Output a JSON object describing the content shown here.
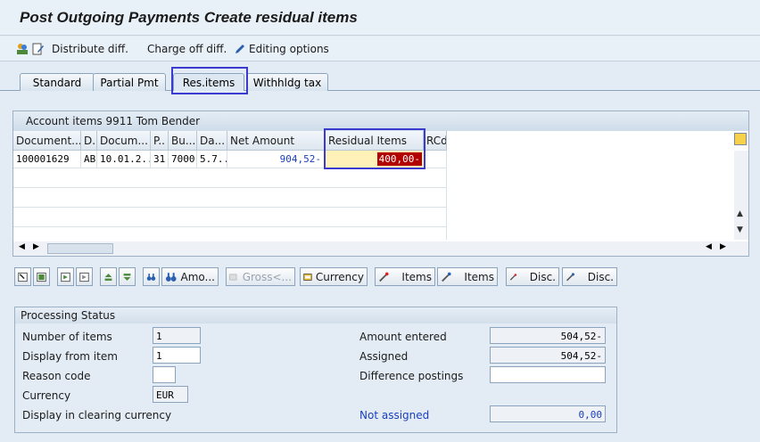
{
  "window": {
    "title": "Post Outgoing Payments Create residual items"
  },
  "toolbar": {
    "distribute_label": "Distribute diff.",
    "charge_off_label": "Charge off diff.",
    "editing_label": "Editing options"
  },
  "tabs": [
    {
      "label": "Standard"
    },
    {
      "label": "Partial Pmt"
    },
    {
      "label": "Res.items"
    },
    {
      "label": "Withhldg tax"
    }
  ],
  "grid": {
    "title": "Account items 9911 Tom Bender",
    "columns": [
      "Document...",
      "D..",
      "Docum...",
      "P..",
      "Bu...",
      "Da...",
      "Net Amount",
      "Residual Items",
      "RCd"
    ],
    "row": [
      "100001629",
      "AB",
      "10.01.2...",
      "31",
      "7000",
      "5.7...",
      "904,52-",
      "400,00-",
      ""
    ]
  },
  "buttons": {
    "amount": "Amo...",
    "gross": "Gross<...",
    "currency": "Currency",
    "items1": "Items",
    "items2": "Items",
    "disc1": "Disc.",
    "disc2": "Disc."
  },
  "processing": {
    "title": "Processing Status",
    "number_items_label": "Number of items",
    "number_items_value": "1",
    "display_from_label": "Display from item",
    "display_from_value": "1",
    "reason_code_label": "Reason code",
    "reason_code_value": "",
    "currency_label": "Currency",
    "currency_value": "EUR",
    "clearing_currency_label": "Display in clearing currency",
    "amount_entered_label": "Amount entered",
    "amount_entered_value": "504,52-",
    "assigned_label": "Assigned",
    "assigned_value": "504,52-",
    "diff_postings_label": "Difference postings",
    "diff_postings_value": "",
    "not_assigned_label": "Not assigned",
    "not_assigned_value": "0,00"
  },
  "colors": {
    "highlight": "#3b3bd0",
    "residual_bg": "#b30000",
    "link_blue": "#1a3fbf"
  }
}
